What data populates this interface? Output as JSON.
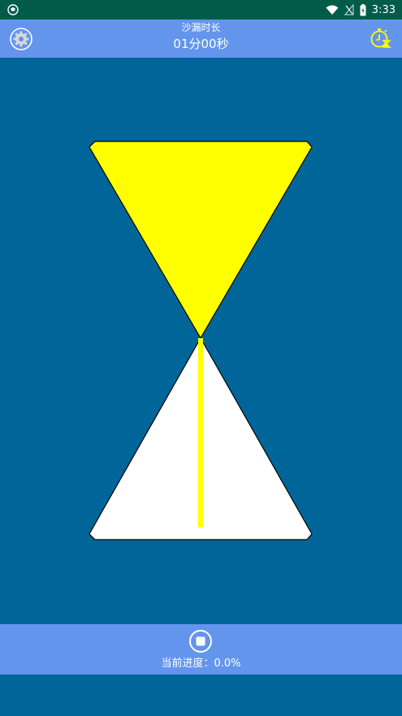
{
  "status_bar": {
    "time": "3:33",
    "icons": [
      "shield-icon",
      "wifi-icon",
      "signal-icon",
      "battery-icon"
    ]
  },
  "header": {
    "label": "沙漏时长",
    "duration": "01分00秒",
    "left_icon": "gear-icon",
    "right_icon": "timer-icon"
  },
  "hourglass": {
    "sand_color": "#ffff00",
    "empty_color": "#ffffff",
    "background": "#006699"
  },
  "footer": {
    "progress_text": "当前进度：0.0%",
    "button_icon": "stop-icon"
  },
  "colors": {
    "bar": "#6495ed",
    "status_bar": "#005c49",
    "accent": "#ffff00"
  }
}
